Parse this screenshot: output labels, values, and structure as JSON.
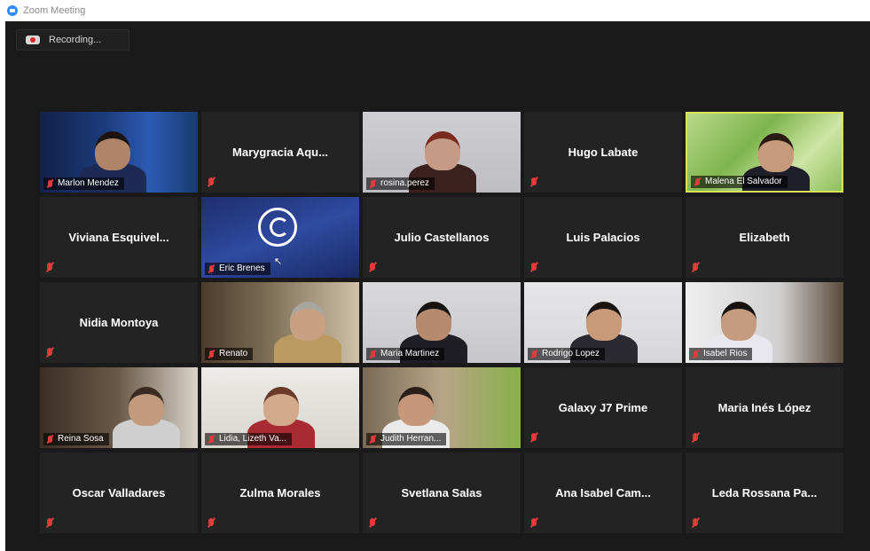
{
  "window": {
    "title": "Zoom Meeting"
  },
  "recording": {
    "label": "Recording..."
  },
  "participants": [
    {
      "name": "Marlon Mendez",
      "video": true
    },
    {
      "name": "Marygracia  Aqu...",
      "video": false
    },
    {
      "name": "rosina.perez",
      "video": true
    },
    {
      "name": "Hugo Labate",
      "video": false
    },
    {
      "name": "Malena El Salvador",
      "video": true,
      "active": true
    },
    {
      "name": "Viviana  Esquivel...",
      "video": false
    },
    {
      "name": "Eric Brenes",
      "video": true
    },
    {
      "name": "Julio Castellanos",
      "video": false
    },
    {
      "name": "Luis Palacios",
      "video": false
    },
    {
      "name": "Elizabeth",
      "video": false
    },
    {
      "name": "Nidia Montoya",
      "video": false
    },
    {
      "name": "Renato",
      "video": true
    },
    {
      "name": "Maria Martinez",
      "video": true
    },
    {
      "name": "Rodrigo Lopez",
      "video": true
    },
    {
      "name": "Isabel Rios",
      "video": true
    },
    {
      "name": "Reina Sosa",
      "video": true
    },
    {
      "name": "Lidia, Lizeth Va...",
      "video": true
    },
    {
      "name": "Judith Herran...",
      "video": true
    },
    {
      "name": "Galaxy J7 Prime",
      "video": false
    },
    {
      "name": "Maria Inés López",
      "video": false
    },
    {
      "name": "Oscar Valladares",
      "video": false
    },
    {
      "name": "Zulma Morales",
      "video": false
    },
    {
      "name": "Svetlana Salas",
      "video": false
    },
    {
      "name": "Ana Isabel Cam...",
      "video": false
    },
    {
      "name": "Leda Rossana Pa...",
      "video": false
    }
  ],
  "colors": {
    "stage": "#1a1a1a",
    "tile": "#232323",
    "active_border": "#d7e35a",
    "muted": "#e23b3b"
  },
  "icons": {
    "app": "zoom-camera-icon",
    "recording": "cloud-record-icon",
    "muted": "muted-mic-icon"
  }
}
